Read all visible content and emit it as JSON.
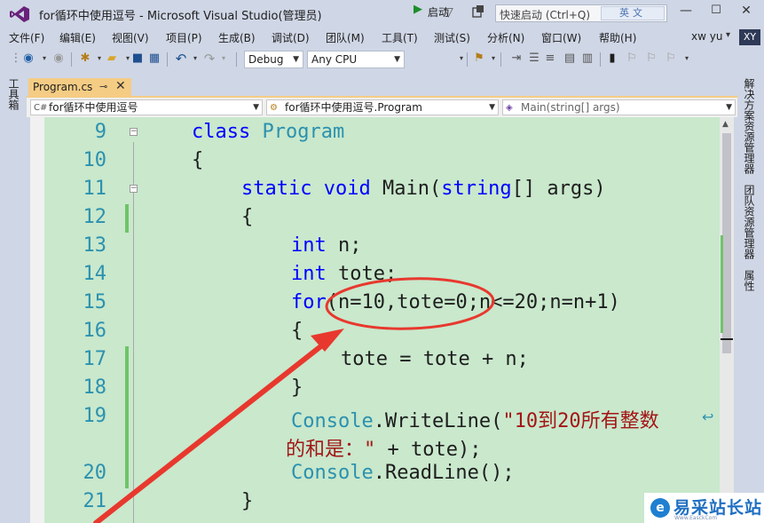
{
  "window": {
    "title": "for循环中使用逗号 - Microsoft Visual Studio(管理员)",
    "quick_launch_placeholder": "快速启动 (Ctrl+Q)",
    "ime_label": "英文"
  },
  "menu": {
    "items": [
      "文件(F)",
      "编辑(E)",
      "视图(V)",
      "项目(P)",
      "生成(B)",
      "调试(D)",
      "团队(M)",
      "工具(T)",
      "测试(S)",
      "分析(N)",
      "窗口(W)",
      "帮助(H)"
    ],
    "user_name": "xw yu",
    "avatar_initials": "XY"
  },
  "toolbar": {
    "config": "Debug",
    "platform": "Any CPU",
    "start_label": "启动"
  },
  "left_panel": {
    "toolbox_label": "工具箱"
  },
  "right_panel": {
    "tabs": [
      "解决方案资源管理器",
      "团队资源管理器",
      "属性"
    ]
  },
  "document_tab": {
    "filename": "Program.cs",
    "pin": "ᛘ"
  },
  "navbar": {
    "project": "for循环中使用逗号",
    "class": "for循环中使用逗号.Program",
    "member": "Main(string[] args)"
  },
  "code": {
    "line_numbers": [
      "9",
      "10",
      "11",
      "12",
      "13",
      "14",
      "15",
      "16",
      "17",
      "18",
      "19",
      "20",
      "21"
    ],
    "lines": {
      "l9_kw": "class",
      "l9_ty": "Program",
      "l10": "{",
      "l11_kw1": "static",
      "l11_kw2": "void",
      "l11_name": "Main(",
      "l11_kw3": "string",
      "l11_rest": "[] args)",
      "l12": "{",
      "l13_kw": "int",
      "l13_rest": " n;",
      "l14_kw": "int",
      "l14_rest": " tote;",
      "l15_kw": "for",
      "l15_rest": "(n=10,tote=0;n<=20;n=n+1)",
      "l16": "{",
      "l17": "tote = tote + n;",
      "l18": "}",
      "l19_ty": "Console",
      "l19_mid": ".WriteLine(",
      "l19_str": "\"10到20所有整数",
      "l19b_str": "的和是：\"",
      "l19b_rest": " + tote);",
      "l20_ty": "Console",
      "l20_rest": ".ReadLine();",
      "l21": "}"
    }
  },
  "watermark": {
    "text": "易采站长站",
    "url": "Www.EasckCom"
  },
  "colors": {
    "editor_bg": "#c9e8cc",
    "keyword": "#0000ff",
    "type": "#2b91af",
    "string": "#a31515",
    "annotation": "#e8382e",
    "tab_active": "#f5cc84"
  }
}
